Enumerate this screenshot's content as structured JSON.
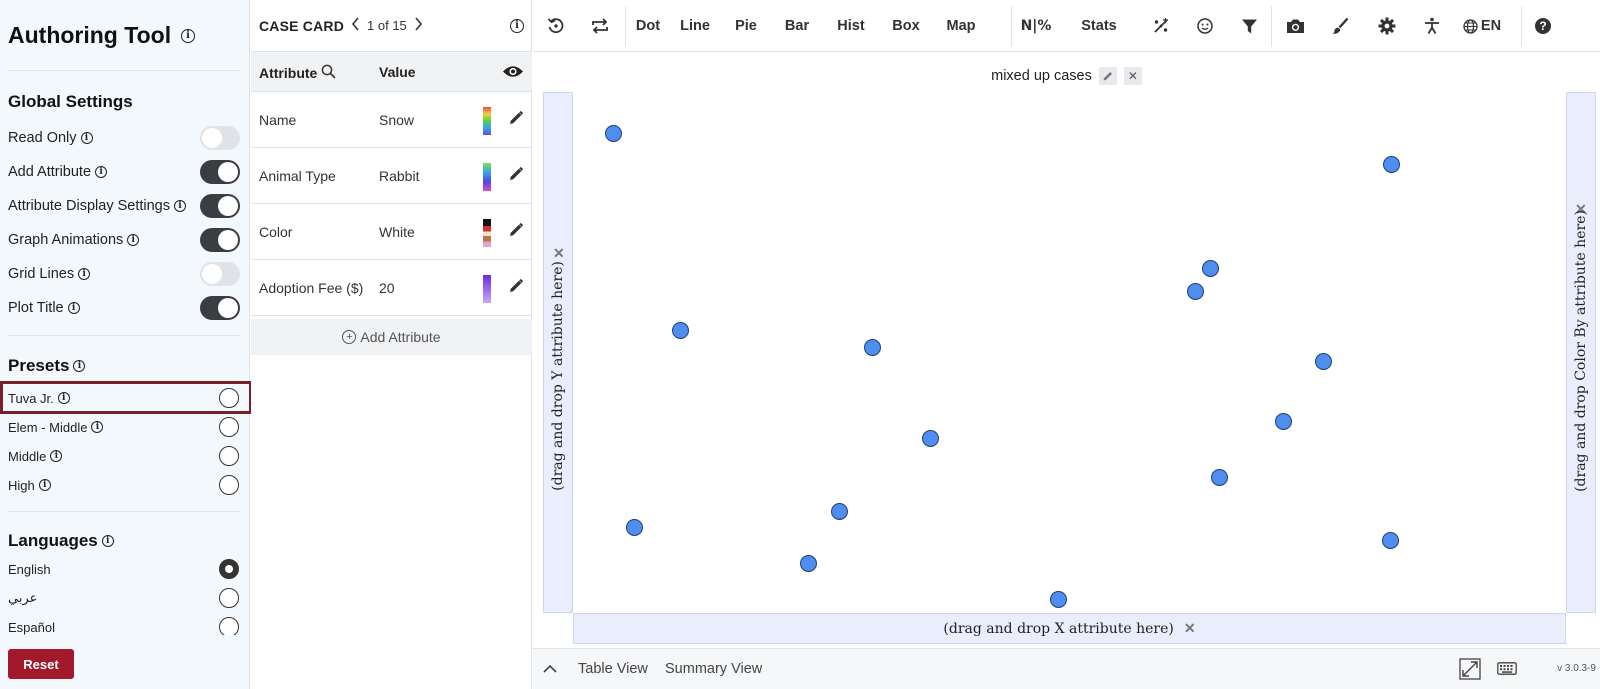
{
  "app": {
    "title": "Authoring Tool"
  },
  "global_settings": {
    "heading": "Global Settings",
    "items": [
      {
        "label": "Read Only",
        "on": false
      },
      {
        "label": "Add Attribute",
        "on": true
      },
      {
        "label": "Attribute Display Settings",
        "on": true
      },
      {
        "label": "Graph Animations",
        "on": true
      },
      {
        "label": "Grid Lines",
        "on": false
      },
      {
        "label": "Plot Title",
        "on": true
      }
    ]
  },
  "presets": {
    "heading": "Presets",
    "items": [
      {
        "label": "Tuva Jr.",
        "checked": false
      },
      {
        "label": "Elem - Middle",
        "checked": false
      },
      {
        "label": "Middle",
        "checked": false
      },
      {
        "label": "High",
        "checked": false
      }
    ]
  },
  "languages": {
    "heading": "Languages",
    "items": [
      {
        "label": "English",
        "checked": true
      },
      {
        "label": "عربي",
        "checked": false
      },
      {
        "label": "Español",
        "checked": false
      }
    ]
  },
  "reset_label": "Reset",
  "case_card": {
    "title": "CASE CARD",
    "count": "1 of 15",
    "col_attribute": "Attribute",
    "col_value": "Value",
    "rows": [
      {
        "name": "Name",
        "value": "Snow"
      },
      {
        "name": "Animal Type",
        "value": "Rabbit"
      },
      {
        "name": "Color",
        "value": "White"
      },
      {
        "name": "Adoption Fee ($)",
        "value": "20"
      }
    ],
    "add_attribute": "Add Attribute"
  },
  "toolbar": {
    "dot": "Dot",
    "line": "Line",
    "pie": "Pie",
    "bar": "Bar",
    "hist": "Hist",
    "box": "Box",
    "map": "Map",
    "n_pct": "N|%",
    "stats": "Stats",
    "lang": "EN"
  },
  "graph": {
    "title": "mixed up cases",
    "y_drop": "(drag and drop Y attribute here)",
    "x_drop": "(drag and drop X attribute here)",
    "color_drop": "(drag and drop Color By attribute here)",
    "points": [
      [
        0.041,
        0.08
      ],
      [
        0.062,
        0.835
      ],
      [
        0.108,
        0.458
      ],
      [
        0.237,
        0.905
      ],
      [
        0.268,
        0.805
      ],
      [
        0.302,
        0.49
      ],
      [
        0.36,
        0.665
      ],
      [
        0.489,
        0.975
      ],
      [
        0.627,
        0.382
      ],
      [
        0.642,
        0.338
      ],
      [
        0.651,
        0.739
      ],
      [
        0.716,
        0.633
      ],
      [
        0.756,
        0.518
      ],
      [
        0.824,
        0.14
      ],
      [
        0.823,
        0.86
      ]
    ]
  },
  "bottom": {
    "table_view": "Table View",
    "summary_view": "Summary View",
    "version": "v 3.0.3-9"
  }
}
